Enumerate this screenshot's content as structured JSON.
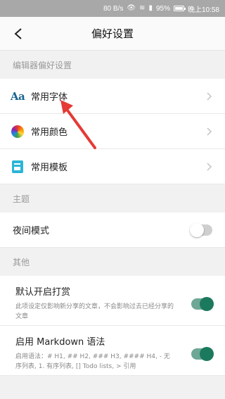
{
  "status_bar": {
    "speed": "80 B/s",
    "battery_percent": "95%",
    "time": "晚上10:58"
  },
  "header": {
    "title": "偏好设置"
  },
  "sections": {
    "editor": {
      "title": "编辑器偏好设置",
      "items": [
        {
          "label": "常用字体",
          "icon": "font-aa-icon",
          "icon_text": "Aa"
        },
        {
          "label": "常用颜色",
          "icon": "color-wheel-icon"
        },
        {
          "label": "常用模板",
          "icon": "template-icon"
        }
      ]
    },
    "theme": {
      "title": "主题",
      "night_mode": {
        "label": "夜间模式",
        "enabled": false
      }
    },
    "other": {
      "title": "其他",
      "reward": {
        "label": "默认开启打赏",
        "description": "此项设定仅影响新分享的文章，不会影响过去已经分享的文章",
        "enabled": true
      },
      "markdown": {
        "label": "启用 Markdown 语法",
        "description": "启用语法：# H1, ## H2, ### H3, #### H4, - 无序列表, 1. 有序列表, [] Todo lists, > 引用",
        "enabled": true
      }
    }
  },
  "colors": {
    "accent": "#1b7a5e",
    "annotation_arrow": "#e53935"
  }
}
